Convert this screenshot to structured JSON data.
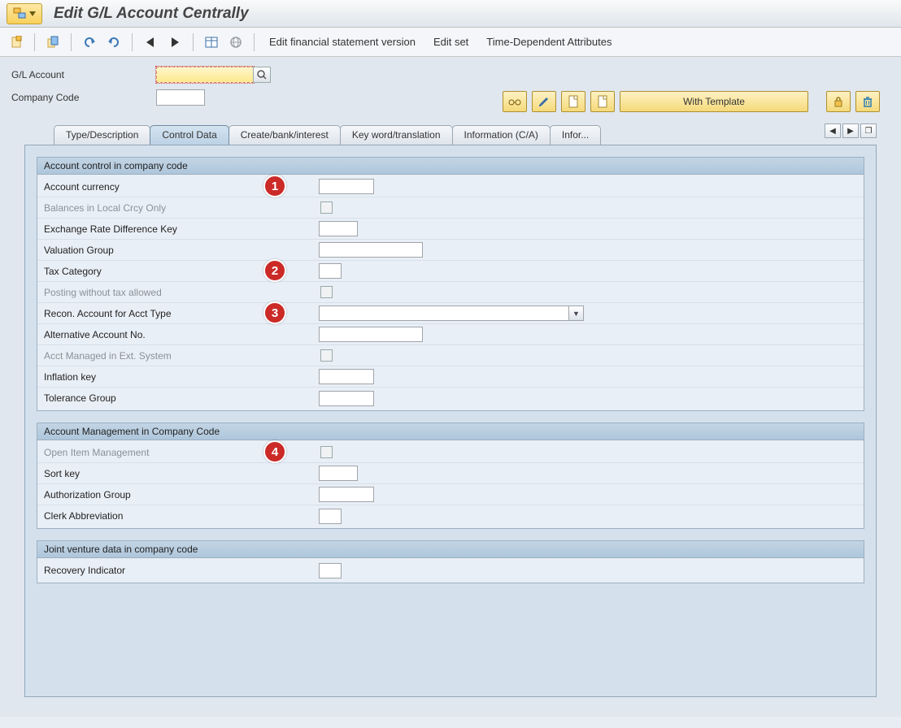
{
  "title": "Edit G/L Account Centrally",
  "toolbar": {
    "links": [
      "Edit financial statement version",
      "Edit set",
      "Time-Dependent Attributes"
    ]
  },
  "header": {
    "gl_label": "G/L Account",
    "cc_label": "Company Code",
    "with_template_label": "With Template"
  },
  "tabs": [
    "Type/Description",
    "Control Data",
    "Create/bank/interest",
    "Key word/translation",
    "Information (C/A)",
    "Infor..."
  ],
  "active_tab_index": 1,
  "groups": [
    {
      "title": "Account control in company code",
      "fields": [
        {
          "label": "Account currency",
          "type": "input",
          "w": "w-md",
          "ann": "1"
        },
        {
          "label": "Balances in Local Crcy Only",
          "type": "check",
          "disabled": true
        },
        {
          "label": "Exchange Rate Difference Key",
          "type": "input",
          "w": "w-sm"
        },
        {
          "label": "Valuation Group",
          "type": "input",
          "w": "w-lg"
        },
        {
          "label": "Tax Category",
          "type": "input",
          "w": "w-xs",
          "ann": "2"
        },
        {
          "label": "Posting without tax allowed",
          "type": "check",
          "disabled": true
        },
        {
          "label": "Recon. Account for Acct Type",
          "type": "dropdown",
          "w": "w-xl",
          "ann": "3"
        },
        {
          "label": "Alternative Account No.",
          "type": "input",
          "w": "w-lg"
        },
        {
          "label": "Acct Managed in Ext. System",
          "type": "check",
          "disabled": true
        },
        {
          "label": "Inflation key",
          "type": "input",
          "w": "w-md"
        },
        {
          "label": "Tolerance Group",
          "type": "input",
          "w": "w-md"
        }
      ]
    },
    {
      "title": "Account Management in Company Code",
      "fields": [
        {
          "label": "Open Item Management",
          "type": "check",
          "disabled": true,
          "ann": "4"
        },
        {
          "label": "Sort key",
          "type": "input",
          "w": "w-sm"
        },
        {
          "label": "Authorization Group",
          "type": "input",
          "w": "w-md"
        },
        {
          "label": "Clerk Abbreviation",
          "type": "input",
          "w": "w-xs"
        }
      ]
    },
    {
      "title": "Joint venture data in company code",
      "fields": [
        {
          "label": "Recovery Indicator",
          "type": "input",
          "w": "w-xs"
        }
      ]
    }
  ],
  "annotations": [
    "1",
    "2",
    "3",
    "4"
  ]
}
